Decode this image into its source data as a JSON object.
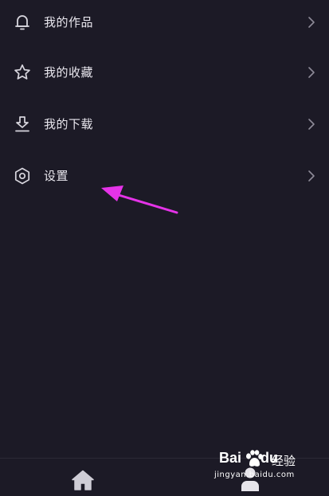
{
  "menu": {
    "items": [
      {
        "label": "我的作品",
        "icon": "bell-icon"
      },
      {
        "label": "我的收藏",
        "icon": "star-icon"
      },
      {
        "label": "我的下载",
        "icon": "download-icon"
      },
      {
        "label": "设置",
        "icon": "gear-icon"
      }
    ]
  },
  "bottom_nav": {
    "items": [
      {
        "icon": "home-icon"
      },
      {
        "icon": "user-icon"
      }
    ]
  },
  "watermark": {
    "brand": "Bai",
    "brand_suffix": "du",
    "product": "经验",
    "url": "jingyan.baidu.com"
  },
  "colors": {
    "background": "#1c1a26",
    "text": "#e9e7ee",
    "annotation_arrow": "#e533e8"
  }
}
